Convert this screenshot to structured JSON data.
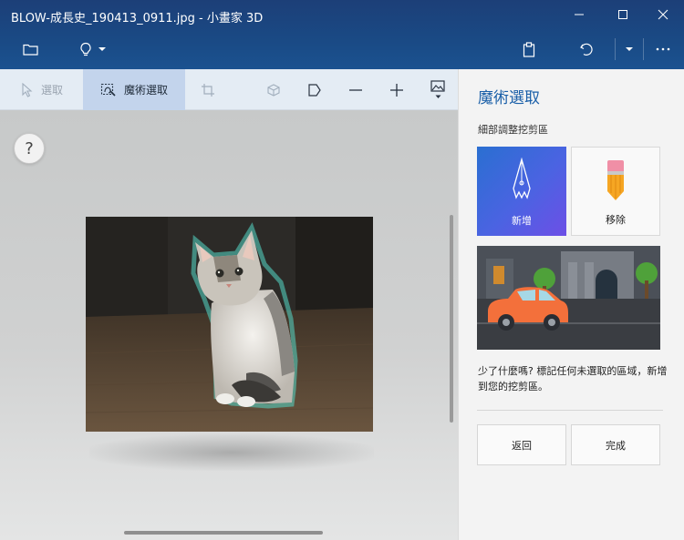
{
  "window": {
    "title": "BLOW-成長史_190413_0911.jpg - 小畫家 3D"
  },
  "toolbar": {
    "tools": [
      {
        "id": "select",
        "label": "選取",
        "icon": "cursor-arrow-icon",
        "state": "disabled"
      },
      {
        "id": "magic-select",
        "label": "魔術選取",
        "icon": "magic-select-icon",
        "state": "active"
      },
      {
        "id": "crop",
        "icon": "crop-icon",
        "state": "disabled"
      },
      {
        "id": "3d-library",
        "icon": "3d-shapes-icon",
        "state": "disabled"
      },
      {
        "id": "flag",
        "icon": "flag-icon"
      },
      {
        "id": "zoom-out",
        "icon": "minus-icon"
      },
      {
        "id": "zoom-in",
        "icon": "plus-icon"
      },
      {
        "id": "view",
        "icon": "image-view-icon"
      }
    ]
  },
  "canvas": {
    "help_label": "?"
  },
  "panel": {
    "title": "魔術選取",
    "subtitle": "細部調整挖剪區",
    "add_label": "新增",
    "remove_label": "移除",
    "hint": "少了什麼嗎? 標記任何未選取的區域，新增到您的挖剪區。",
    "back_label": "返回",
    "done_label": "完成"
  },
  "colors": {
    "accent": "#1a5fa8",
    "header": "#1a4a85",
    "toolbar": "#e4ecf4",
    "active_tool": "#c3d4ec",
    "add_card_start": "#2a6fd1",
    "add_card_end": "#6d4fe6"
  }
}
